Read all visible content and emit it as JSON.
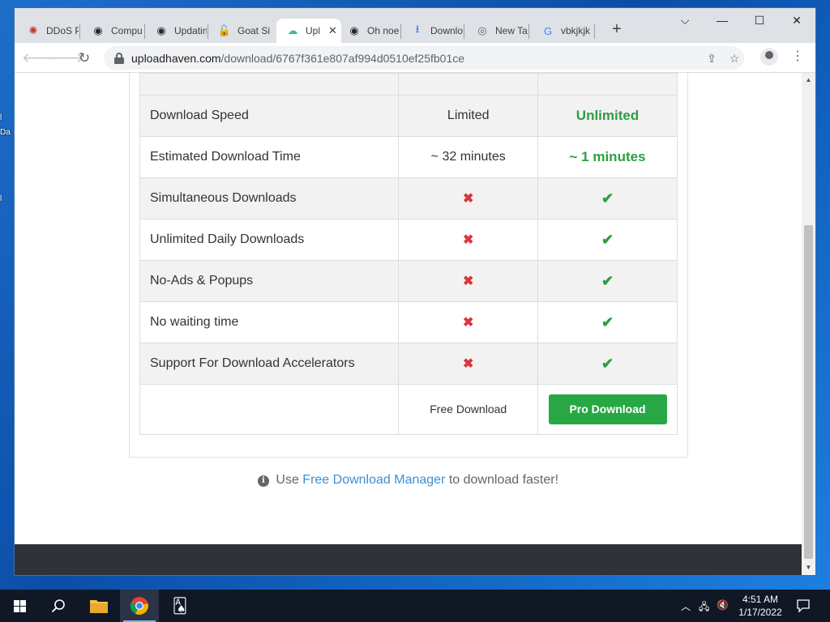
{
  "desktop": {
    "fragments": [
      "l",
      "Da",
      "l"
    ]
  },
  "browser": {
    "tabs": [
      {
        "title": "DDoS P",
        "icon": "ddos-favicon",
        "glyph": "✺",
        "color": "#c0392b"
      },
      {
        "title": "Compu",
        "icon": "github-favicon",
        "glyph": "◉",
        "color": "#24292e"
      },
      {
        "title": "Updatin",
        "icon": "github-favicon",
        "glyph": "◉",
        "color": "#24292e"
      },
      {
        "title": "Goat Si",
        "icon": "lock-favicon",
        "glyph": "🔓",
        "color": "#d93025"
      },
      {
        "title": "Upl",
        "icon": "uploadhaven-favicon",
        "glyph": "☁",
        "color": "#3dbf9a",
        "active": true
      },
      {
        "title": "Oh noe",
        "icon": "github-favicon",
        "glyph": "◉",
        "color": "#24292e"
      },
      {
        "title": "Downlo",
        "icon": "download-favicon",
        "glyph": "⭳",
        "color": "#1a73e8"
      },
      {
        "title": "New Ta",
        "icon": "chrome-favicon",
        "glyph": "◎",
        "color": "#5f6368"
      },
      {
        "title": "vbkjkjk",
        "icon": "google-favicon",
        "glyph": "G",
        "color": "#4285f4"
      }
    ],
    "url_domain": "uploadhaven.com",
    "url_path": "/download/6767f361e807af994d0510ef25fb01ce"
  },
  "comparison": {
    "rows": [
      {
        "feature": "Download Speed",
        "free": "Limited",
        "pro": "Unlimited",
        "kind": "text"
      },
      {
        "feature": "Estimated Download Time",
        "free": "~ 32 minutes",
        "pro": "~ 1 minutes",
        "kind": "text"
      },
      {
        "feature": "Simultaneous Downloads",
        "free": "✖",
        "pro": "✔",
        "kind": "mark"
      },
      {
        "feature": "Unlimited Daily Downloads",
        "free": "✖",
        "pro": "✔",
        "kind": "mark"
      },
      {
        "feature": "No-Ads & Popups",
        "free": "✖",
        "pro": "✔",
        "kind": "mark"
      },
      {
        "feature": "No waiting time",
        "free": "✖",
        "pro": "✔",
        "kind": "mark"
      },
      {
        "feature": "Support For Download Accelerators",
        "free": "✖",
        "pro": "✔",
        "kind": "mark"
      }
    ],
    "free_button": "Free Download",
    "pro_button": "Pro Download"
  },
  "tip": {
    "icon": "info-icon",
    "prefix": "Use",
    "link": "Free Download Manager",
    "suffix": "to download faster!"
  },
  "taskbar": {
    "time": "4:51 AM",
    "date": "1/17/2022"
  },
  "colors": {
    "pro_green": "#2e9e44",
    "cross_red": "#d9363e",
    "link_blue": "#3a8fd6"
  }
}
